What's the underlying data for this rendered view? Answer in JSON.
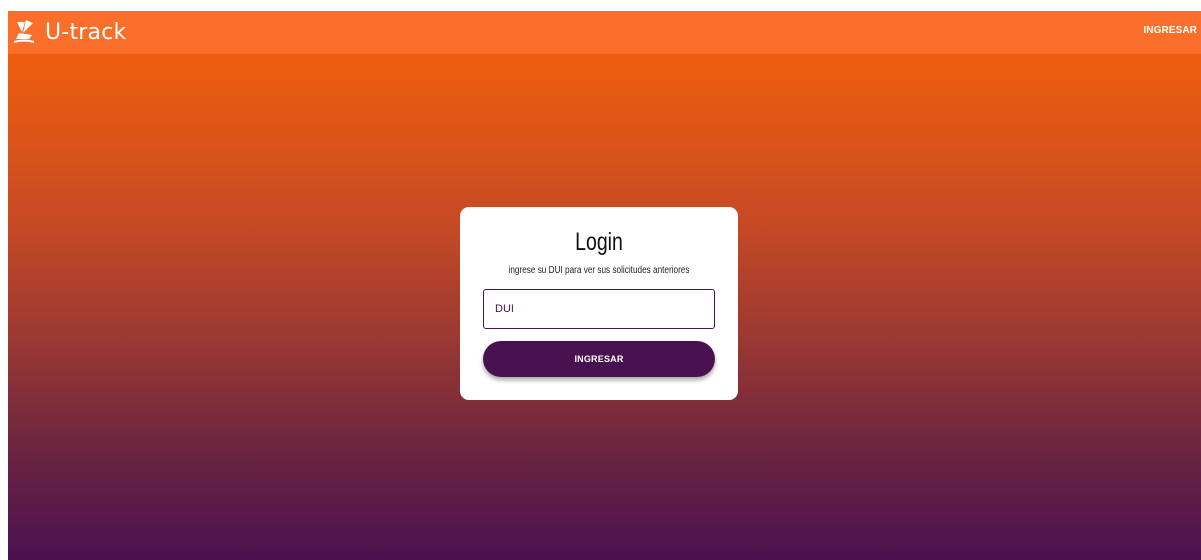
{
  "navbar": {
    "brand_icon": "ship-logo-icon",
    "brand_name": "U-track",
    "login_link": "INGRESAR",
    "background_color": "#fb6f2a"
  },
  "login": {
    "title": "Login",
    "subtitle": "ingrese su DUI para ver sus solicitudes anteriores",
    "dui_placeholder": "DUI",
    "dui_value": "",
    "submit_label": "INGRESAR"
  },
  "colors": {
    "gradient_top": "#fb5f0c",
    "gradient_bottom": "#4a1150",
    "accent": "#4a1150",
    "card": "#ffffff"
  }
}
